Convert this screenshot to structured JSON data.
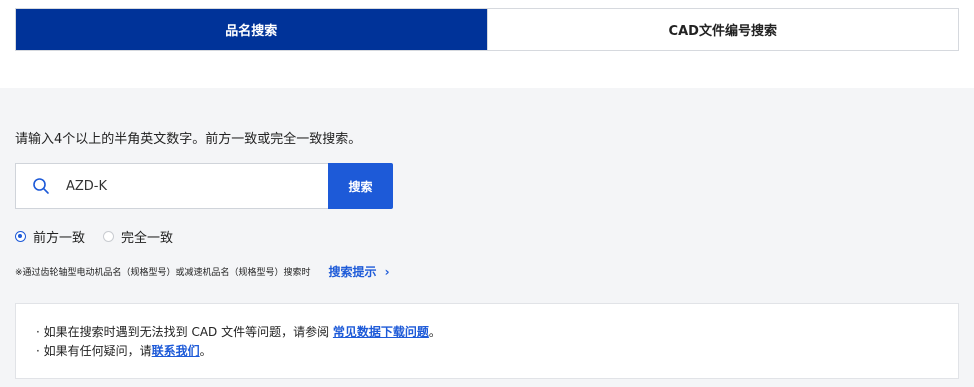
{
  "tabs": {
    "active_label": "品名搜索",
    "inactive_label": "CAD文件编号搜索"
  },
  "search": {
    "hint": "请输入4个以上的半角英文数字。前方一致或完全一致搜索。",
    "value": "AZD-K",
    "button_label": "搜索"
  },
  "match_options": {
    "prefix_label": "前方一致",
    "exact_label": "完全一致",
    "selected": "前方一致"
  },
  "note": {
    "text": "※通过齿轮轴型电动机品名（规格型号）或减速机品名（规格型号）搜索时",
    "link_label": "搜索提示"
  },
  "info": {
    "line1_prefix": "· 如果在搜索时遇到无法找到 CAD 文件等问题，请参阅 ",
    "line1_link": "常见数据下载问题",
    "line1_suffix": "。",
    "line2_prefix": "· 如果有任何疑问，请",
    "line2_link": "联系我们",
    "line2_suffix": "。"
  },
  "colors": {
    "active_tab": "#003399",
    "accent": "#1d5ad8",
    "panel_bg": "#f4f5f7"
  }
}
